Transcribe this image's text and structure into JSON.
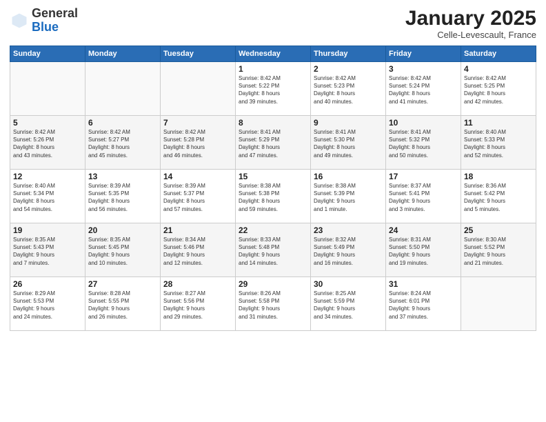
{
  "logo": {
    "general": "General",
    "blue": "Blue"
  },
  "header": {
    "month": "January 2025",
    "location": "Celle-Levescault, France"
  },
  "weekdays": [
    "Sunday",
    "Monday",
    "Tuesday",
    "Wednesday",
    "Thursday",
    "Friday",
    "Saturday"
  ],
  "weeks": [
    [
      {
        "day": "",
        "info": ""
      },
      {
        "day": "",
        "info": ""
      },
      {
        "day": "",
        "info": ""
      },
      {
        "day": "1",
        "info": "Sunrise: 8:42 AM\nSunset: 5:22 PM\nDaylight: 8 hours\nand 39 minutes."
      },
      {
        "day": "2",
        "info": "Sunrise: 8:42 AM\nSunset: 5:23 PM\nDaylight: 8 hours\nand 40 minutes."
      },
      {
        "day": "3",
        "info": "Sunrise: 8:42 AM\nSunset: 5:24 PM\nDaylight: 8 hours\nand 41 minutes."
      },
      {
        "day": "4",
        "info": "Sunrise: 8:42 AM\nSunset: 5:25 PM\nDaylight: 8 hours\nand 42 minutes."
      }
    ],
    [
      {
        "day": "5",
        "info": "Sunrise: 8:42 AM\nSunset: 5:26 PM\nDaylight: 8 hours\nand 43 minutes."
      },
      {
        "day": "6",
        "info": "Sunrise: 8:42 AM\nSunset: 5:27 PM\nDaylight: 8 hours\nand 45 minutes."
      },
      {
        "day": "7",
        "info": "Sunrise: 8:42 AM\nSunset: 5:28 PM\nDaylight: 8 hours\nand 46 minutes."
      },
      {
        "day": "8",
        "info": "Sunrise: 8:41 AM\nSunset: 5:29 PM\nDaylight: 8 hours\nand 47 minutes."
      },
      {
        "day": "9",
        "info": "Sunrise: 8:41 AM\nSunset: 5:30 PM\nDaylight: 8 hours\nand 49 minutes."
      },
      {
        "day": "10",
        "info": "Sunrise: 8:41 AM\nSunset: 5:32 PM\nDaylight: 8 hours\nand 50 minutes."
      },
      {
        "day": "11",
        "info": "Sunrise: 8:40 AM\nSunset: 5:33 PM\nDaylight: 8 hours\nand 52 minutes."
      }
    ],
    [
      {
        "day": "12",
        "info": "Sunrise: 8:40 AM\nSunset: 5:34 PM\nDaylight: 8 hours\nand 54 minutes."
      },
      {
        "day": "13",
        "info": "Sunrise: 8:39 AM\nSunset: 5:35 PM\nDaylight: 8 hours\nand 56 minutes."
      },
      {
        "day": "14",
        "info": "Sunrise: 8:39 AM\nSunset: 5:37 PM\nDaylight: 8 hours\nand 57 minutes."
      },
      {
        "day": "15",
        "info": "Sunrise: 8:38 AM\nSunset: 5:38 PM\nDaylight: 8 hours\nand 59 minutes."
      },
      {
        "day": "16",
        "info": "Sunrise: 8:38 AM\nSunset: 5:39 PM\nDaylight: 9 hours\nand 1 minute."
      },
      {
        "day": "17",
        "info": "Sunrise: 8:37 AM\nSunset: 5:41 PM\nDaylight: 9 hours\nand 3 minutes."
      },
      {
        "day": "18",
        "info": "Sunrise: 8:36 AM\nSunset: 5:42 PM\nDaylight: 9 hours\nand 5 minutes."
      }
    ],
    [
      {
        "day": "19",
        "info": "Sunrise: 8:35 AM\nSunset: 5:43 PM\nDaylight: 9 hours\nand 7 minutes."
      },
      {
        "day": "20",
        "info": "Sunrise: 8:35 AM\nSunset: 5:45 PM\nDaylight: 9 hours\nand 10 minutes."
      },
      {
        "day": "21",
        "info": "Sunrise: 8:34 AM\nSunset: 5:46 PM\nDaylight: 9 hours\nand 12 minutes."
      },
      {
        "day": "22",
        "info": "Sunrise: 8:33 AM\nSunset: 5:48 PM\nDaylight: 9 hours\nand 14 minutes."
      },
      {
        "day": "23",
        "info": "Sunrise: 8:32 AM\nSunset: 5:49 PM\nDaylight: 9 hours\nand 16 minutes."
      },
      {
        "day": "24",
        "info": "Sunrise: 8:31 AM\nSunset: 5:50 PM\nDaylight: 9 hours\nand 19 minutes."
      },
      {
        "day": "25",
        "info": "Sunrise: 8:30 AM\nSunset: 5:52 PM\nDaylight: 9 hours\nand 21 minutes."
      }
    ],
    [
      {
        "day": "26",
        "info": "Sunrise: 8:29 AM\nSunset: 5:53 PM\nDaylight: 9 hours\nand 24 minutes."
      },
      {
        "day": "27",
        "info": "Sunrise: 8:28 AM\nSunset: 5:55 PM\nDaylight: 9 hours\nand 26 minutes."
      },
      {
        "day": "28",
        "info": "Sunrise: 8:27 AM\nSunset: 5:56 PM\nDaylight: 9 hours\nand 29 minutes."
      },
      {
        "day": "29",
        "info": "Sunrise: 8:26 AM\nSunset: 5:58 PM\nDaylight: 9 hours\nand 31 minutes."
      },
      {
        "day": "30",
        "info": "Sunrise: 8:25 AM\nSunset: 5:59 PM\nDaylight: 9 hours\nand 34 minutes."
      },
      {
        "day": "31",
        "info": "Sunrise: 8:24 AM\nSunset: 6:01 PM\nDaylight: 9 hours\nand 37 minutes."
      },
      {
        "day": "",
        "info": ""
      }
    ]
  ]
}
